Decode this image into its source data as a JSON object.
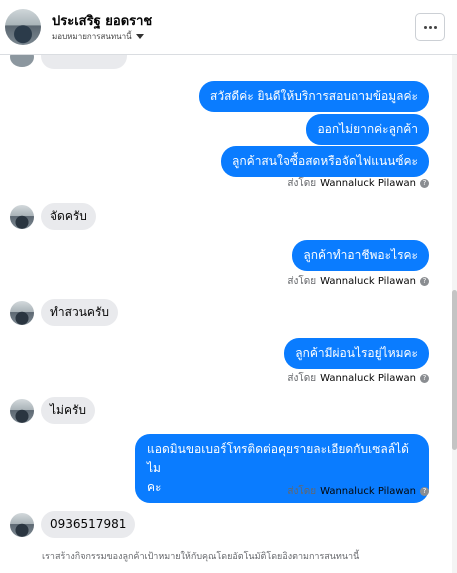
{
  "header": {
    "name": "ประเสริฐ ยอดราช",
    "assign_label": "มอบหมายการสนทนานี้",
    "more_icon": "more-horizontal-icon"
  },
  "messages": {
    "out1": "สวัสดีค่ะ  ยินดีให้บริการสอบถามข้อมูลค่ะ",
    "out2": "ออกไม่ยากค่ะลูกค้า",
    "out3": "ลูกค้าสนใจซื้อสดหรือจัดไฟแนนซ์คะ",
    "in1": "จัดครับ",
    "out4": "ลูกค้าทำอาชีพอะไรคะ",
    "in2": "ทำสวนครับ",
    "out5": "ลูกค้ามีผ่อนไรอยู่ไหมคะ",
    "in3": "ไม่ครับ",
    "out6_line1": "แอดมินขอเบอร์โทรติดต่อคุยรายละเอียดกับเซลล์ได้ไม",
    "out6_line2": "คะ",
    "in4": "0936517981"
  },
  "sent_by": {
    "prefix": "ส่งโดย",
    "name": "Wannaluck Pilawan",
    "help_icon": "?"
  },
  "footer": {
    "note": "เราสร้างกิจกรรมของลูกค้าเป้าหมายให้กับคุณโดยอัตโนมัติโดยอิงตามการสนทนานี้"
  },
  "colors": {
    "outgoing": "#0a7cff",
    "incoming": "#e9eaed"
  }
}
